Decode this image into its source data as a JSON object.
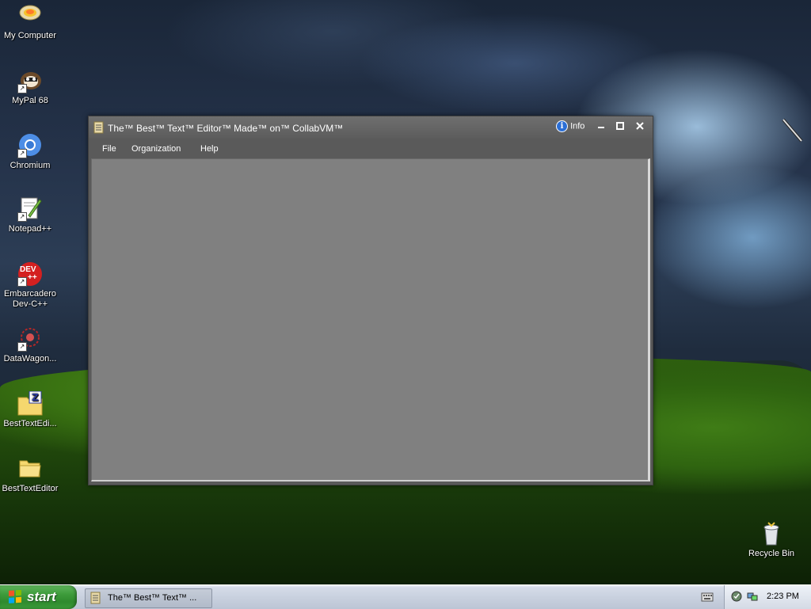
{
  "desktop": {
    "icons": [
      {
        "label": "My Computer",
        "icon": "my-computer-icon"
      },
      {
        "label": "MyPal 68",
        "icon": "mypal-icon"
      },
      {
        "label": "Chromium",
        "icon": "chromium-icon"
      },
      {
        "label": "Notepad++",
        "icon": "notepadpp-icon"
      },
      {
        "label": "Embarcadero Dev-C++",
        "line1": "Embarcadero",
        "line2": "Dev-C++",
        "icon": "devcpp-icon"
      },
      {
        "label": "DataWagon...",
        "icon": "datawagon-icon"
      },
      {
        "label": "BestTextEdi...",
        "icon": "winzip-folder-icon"
      },
      {
        "label": "BestTextEditor",
        "icon": "folder-icon"
      },
      {
        "label": "Recycle Bin",
        "icon": "recycle-bin-icon"
      }
    ],
    "devcpp_badge": "DEV",
    "devcpp_badge2": "++"
  },
  "window": {
    "title": "The™ Best™ Text™ Editor™ Made™ on™ CollabVM™",
    "info_label": "Info",
    "info_glyph": "i",
    "menu": [
      "File",
      "Organization",
      "Help"
    ],
    "editor_content": ""
  },
  "taskbar": {
    "start_label": "start",
    "task_button": "The™ Best™ Text™ ...",
    "clock": "2:23 PM"
  },
  "colors": {
    "window_bg": "#5a5a5a",
    "editor_bg": "#808080",
    "start_green": "#3c9a3a"
  }
}
